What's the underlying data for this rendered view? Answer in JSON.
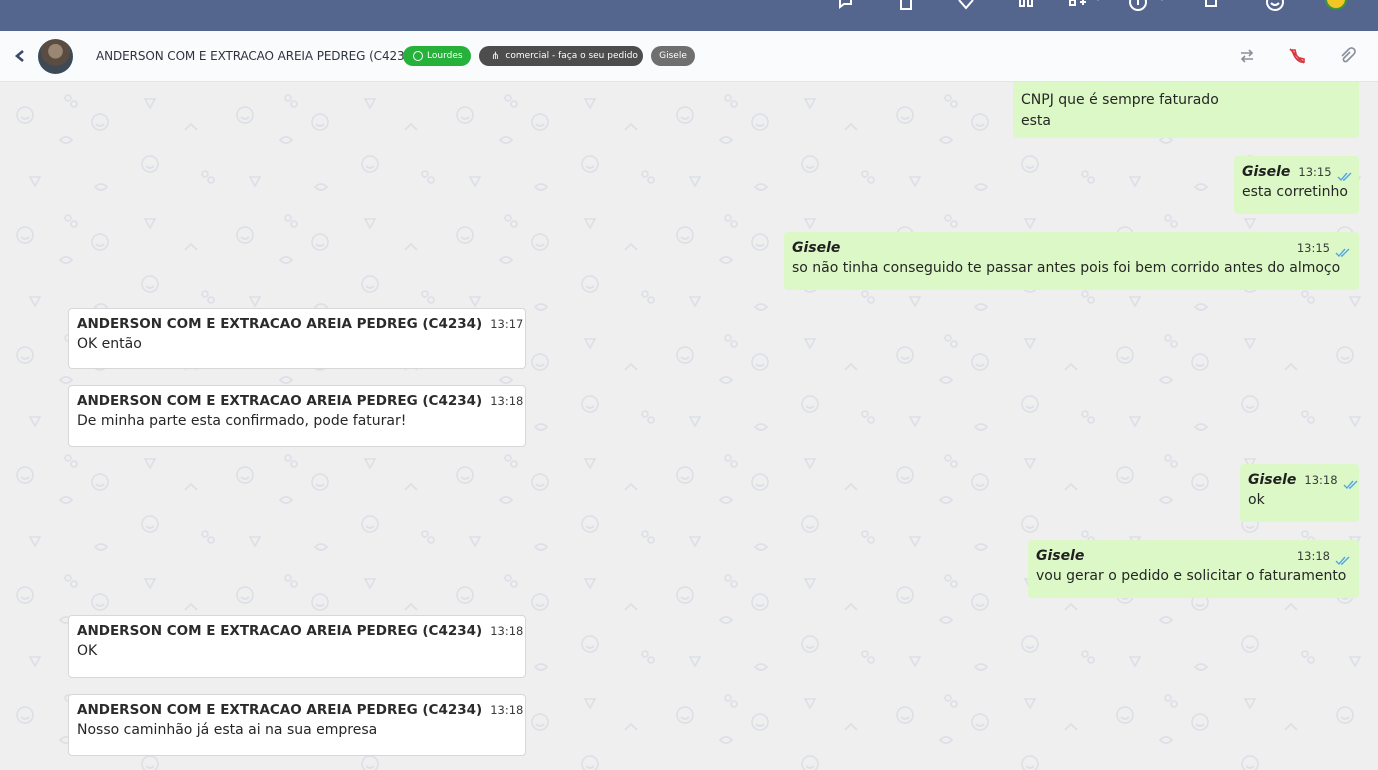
{
  "topbar": {
    "icons": [
      "chat-bubbles-icon",
      "clipboard-icon",
      "heart-icon",
      "headset-icon",
      "apps-grid-icon",
      "info-icon",
      "bell-icon",
      "smiley-icon",
      "profile-status-icon"
    ]
  },
  "header": {
    "contact_name": "ANDERSON COM E EXTRACAO AREIA PEDREG (C4234)",
    "channel_tag": "Lourdes",
    "queue_tag": "comercial - faça o seu pedido",
    "user_tag": "Gisele",
    "colors": {
      "channel": "#25b13a",
      "queue": "#4d4d4d",
      "user": "#6f6f6f",
      "hangup": "#d9363e"
    }
  },
  "messages": [
    {
      "dir": "out",
      "sender": "",
      "time": "",
      "lines": [
        "CNPJ que é sempre faturado",
        "esta"
      ]
    },
    {
      "dir": "out",
      "sender": "Gisele",
      "time": "13:15",
      "lines": [
        "esta corretinho"
      ]
    },
    {
      "dir": "out",
      "sender": "Gisele",
      "time": "13:15",
      "lines": [
        "so não tinha conseguido te passar antes pois foi bem corrido antes do almoço"
      ]
    },
    {
      "dir": "in",
      "sender": "ANDERSON COM E EXTRACAO AREIA PEDREG (C4234)",
      "time": "13:17",
      "lines": [
        "OK então"
      ]
    },
    {
      "dir": "in",
      "sender": "ANDERSON COM E EXTRACAO AREIA PEDREG (C4234)",
      "time": "13:18",
      "lines": [
        "De minha parte esta confirmado, pode faturar!"
      ]
    },
    {
      "dir": "out",
      "sender": "Gisele",
      "time": "13:18",
      "lines": [
        "ok"
      ]
    },
    {
      "dir": "out",
      "sender": "Gisele",
      "time": "13:18",
      "lines": [
        "vou gerar o pedido e solicitar o faturamento"
      ]
    },
    {
      "dir": "in",
      "sender": "ANDERSON COM E EXTRACAO AREIA PEDREG (C4234)",
      "time": "13:18",
      "lines": [
        "OK"
      ]
    },
    {
      "dir": "in",
      "sender": "ANDERSON COM E EXTRACAO AREIA PEDREG (C4234)",
      "time": "13:18",
      "lines": [
        "Nosso caminhão já esta ai na sua empresa"
      ]
    }
  ]
}
